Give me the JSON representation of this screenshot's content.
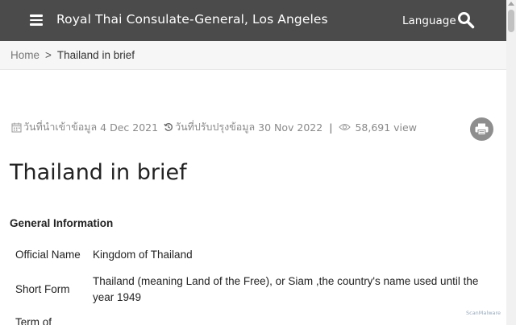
{
  "header": {
    "site_title": "Royal Thai Consulate-General, Los Angeles",
    "language_label": "Language",
    "menu_icon": "hamburger-menu-icon",
    "search_icon": "search-icon",
    "background_color": "#4b4b4b"
  },
  "breadcrumb": {
    "home": "Home",
    "separator": ">",
    "current": "Thailand in brief"
  },
  "meta": {
    "created_label": "วันที่นำเข้าข้อมูล",
    "created_date": "4 Dec 2021",
    "updated_label": "วันที่ปรับปรุงข้อมูล",
    "updated_date": "30 Nov 2022",
    "separator": "|",
    "views": "58,691 view"
  },
  "page": {
    "title": "Thailand in brief",
    "section_title": "General Information"
  },
  "info": [
    {
      "label": "Official Name",
      "value": "Kingdom of Thailand"
    },
    {
      "label": "Short Form",
      "value": "Thailand (meaning Land of the Free), or Siam ,the country's name used until the year 1949"
    },
    {
      "label": "Term of",
      "value": ""
    }
  ],
  "watermark": "ScanMalware"
}
